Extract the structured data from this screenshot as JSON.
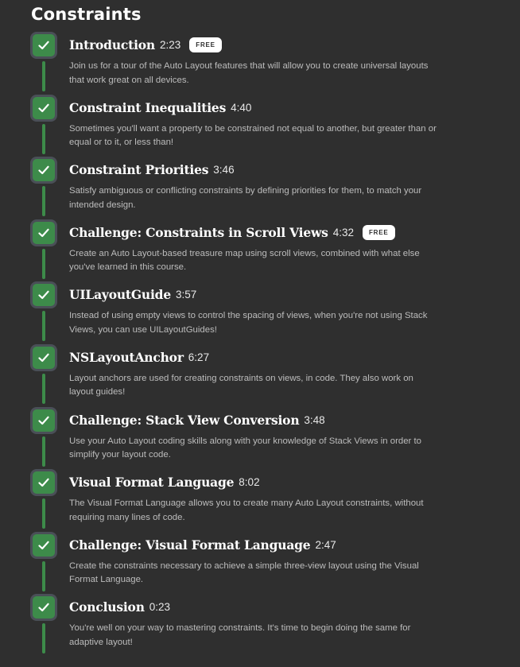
{
  "page": {
    "title": "Constraints"
  },
  "colors": {
    "background": "#2f2f2f",
    "accent_green": "#3d8b4a",
    "check_border": "#4a4f57",
    "description": "#bcbcbc"
  },
  "icons": {
    "completed": "checkmark-icon"
  },
  "lessons": [
    {
      "title": "Introduction",
      "duration": "2:23",
      "badge": "FREE",
      "completed": true,
      "description": "Join us for a tour of the Auto Layout features that will allow you to create universal layouts that work great on all devices."
    },
    {
      "title": "Constraint Inequalities",
      "duration": "4:40",
      "badge": "",
      "completed": true,
      "description": "Sometimes you'll want a property to be constrained not equal to another, but greater than or equal or to it, or less than!"
    },
    {
      "title": "Constraint Priorities",
      "duration": "3:46",
      "badge": "",
      "completed": true,
      "description": "Satisfy ambiguous or conflicting constraints by defining priorities for them, to match your intended design."
    },
    {
      "title": "Challenge: Constraints in Scroll Views",
      "duration": "4:32",
      "badge": "FREE",
      "completed": true,
      "description": "Create an Auto Layout-based treasure map using scroll views, combined with what else you've learned in this course."
    },
    {
      "title": "UILayoutGuide",
      "duration": "3:57",
      "badge": "",
      "completed": true,
      "description": "Instead of using empty views to control the spacing of views, when you're not using Stack Views, you can use UILayoutGuides!"
    },
    {
      "title": "NSLayoutAnchor",
      "duration": "6:27",
      "badge": "",
      "completed": true,
      "description": "Layout anchors are used for creating constraints on views, in code. They also work on layout guides!"
    },
    {
      "title": "Challenge: Stack View Conversion",
      "duration": "3:48",
      "badge": "",
      "completed": true,
      "description": "Use your Auto Layout coding skills along with your knowledge of Stack Views in order to simplify your layout code."
    },
    {
      "title": "Visual Format Language",
      "duration": "8:02",
      "badge": "",
      "completed": true,
      "description": "The Visual Format Language allows you to create many Auto Layout constraints, without requiring many lines of code."
    },
    {
      "title": "Challenge: Visual Format Language",
      "duration": "2:47",
      "badge": "",
      "completed": true,
      "description": "Create the constraints necessary to achieve a simple three-view layout using the Visual Format Language."
    },
    {
      "title": "Conclusion",
      "duration": "0:23",
      "badge": "",
      "completed": true,
      "description": "You're well on your way to mastering constraints. It's time to begin doing the same for adaptive layout!"
    }
  ]
}
